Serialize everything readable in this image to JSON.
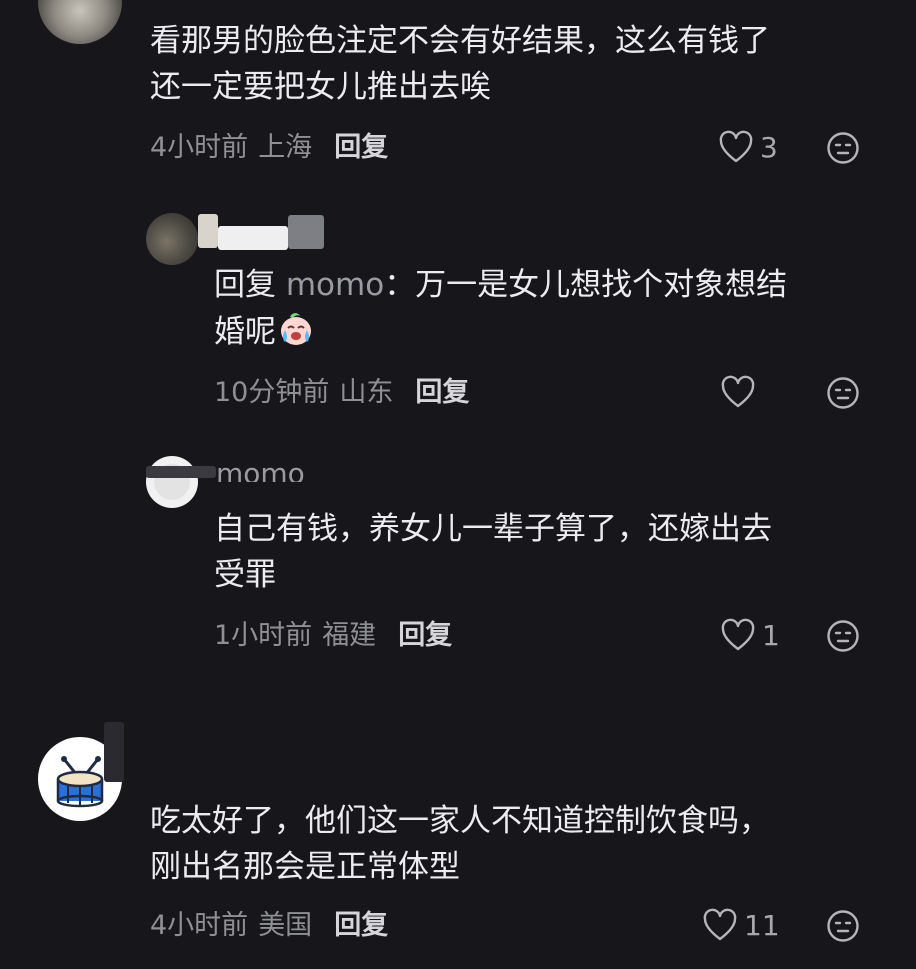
{
  "comments": [
    {
      "text_line1": "看那男的脸色注定不会有好结果，这么有钱了",
      "text_line2": "还一定要把女儿推出去唉",
      "time": "4小时前",
      "location": "上海",
      "reply_label": "回复",
      "likes": "3"
    },
    {
      "reply_prefix": "回复",
      "reply_to": "momo",
      "text_line1_rest": "：万一是女儿想找个对象想结",
      "text_line2": "婚呢",
      "time": "10分钟前",
      "location": "山东",
      "reply_label": "回复",
      "likes": ""
    },
    {
      "author": "momo",
      "text_line1": "自己有钱，养女儿一辈子算了，还嫁出去",
      "text_line2": "受罪",
      "time": "1小时前",
      "location": "福建",
      "reply_label": "回复",
      "likes": "1"
    },
    {
      "text_line1": "吃太好了，他们这一家人不知道控制饮食吗，",
      "text_line2": "刚出名那会是正常体型",
      "time": "4小时前",
      "location": "美国",
      "reply_label": "回复",
      "likes": "11"
    }
  ],
  "colors": {
    "background": "#17171b",
    "text": "#ececef",
    "meta": "#8f8f96"
  },
  "icons": {
    "like": "heart-outline-icon",
    "dislike": "neutral-face-icon",
    "emoji": "crying-face-emoji"
  }
}
